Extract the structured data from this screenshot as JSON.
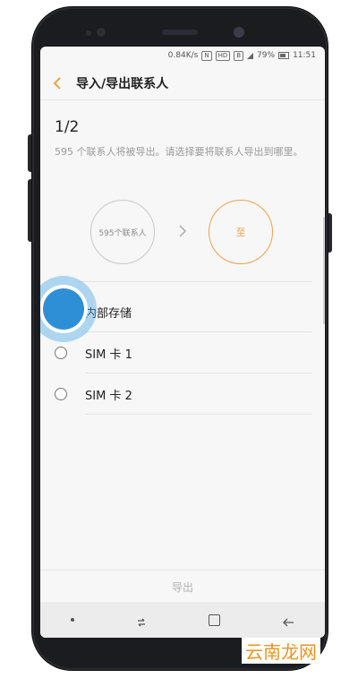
{
  "status_bar": {
    "speed": "0.84K/s",
    "badges": [
      "N",
      "HD",
      "B"
    ],
    "battery": "79%",
    "time": "11:51"
  },
  "app_bar": {
    "title": "导入/导出联系人"
  },
  "step": "1/2",
  "description": "595 个联系人将被导出。请选择要将联系人导出到哪里。",
  "source_circle": "595个联系人",
  "target_circle": "至",
  "options": [
    {
      "label": "内部存储"
    },
    {
      "label": "SIM 卡 1"
    },
    {
      "label": "SIM 卡 2"
    }
  ],
  "export_button": "导出",
  "watermark": "云南龙网",
  "colors": {
    "accent": "#f0a04b",
    "touch": "#2f8fd6"
  }
}
